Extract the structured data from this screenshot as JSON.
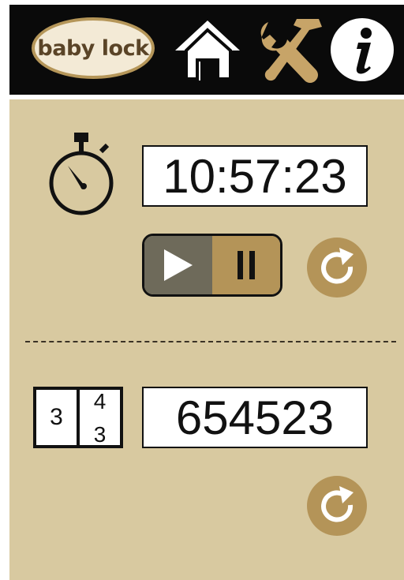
{
  "header": {
    "brand": "baby lock",
    "icons": {
      "home": "home-icon",
      "tools": "tools-icon",
      "info": "info-icon"
    }
  },
  "timer": {
    "display": "10:57:23",
    "icons": {
      "stopwatch": "stopwatch-icon",
      "play": "play-icon",
      "pause": "pause-icon",
      "reset": "reset-icon"
    }
  },
  "counter": {
    "display": "654523",
    "icon_digits": {
      "left": "3",
      "right_top": "4",
      "right_bottom": "3"
    },
    "icons": {
      "counter": "counter-icon",
      "reset": "reset-icon"
    }
  },
  "colors": {
    "header_bg": "#0a0a0a",
    "panel_bg": "#d8c9a0",
    "accent_gold": "#b49458",
    "play_bg": "#6e6a5a"
  }
}
